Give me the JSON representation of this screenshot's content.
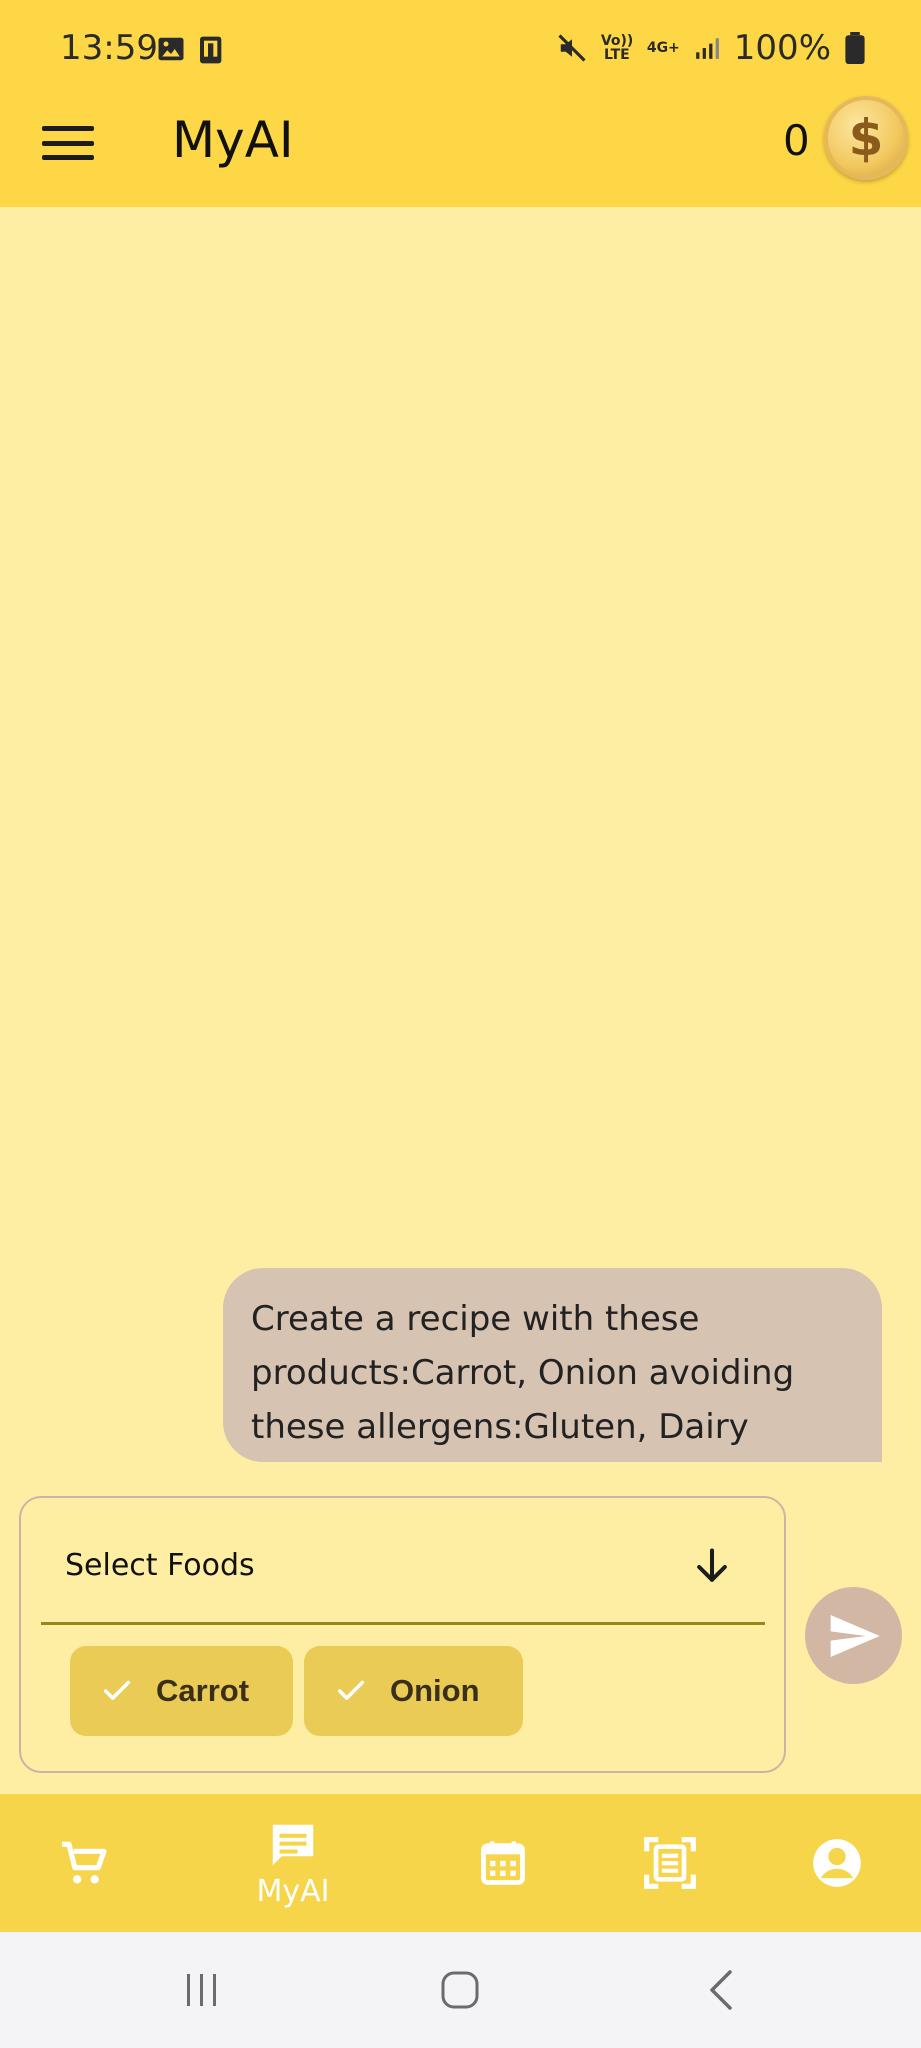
{
  "status_bar": {
    "time": "13:59",
    "battery": "100%",
    "volte": "Vo)) LTE",
    "network": "4G+"
  },
  "app_bar": {
    "title": "MyAI",
    "coin_count": "0",
    "coin_symbol": "$"
  },
  "chat": {
    "messages": [
      {
        "role": "user",
        "text": "Create a recipe with these products:Carrot, Onion avoiding these allergens:Gluten, Dairy"
      }
    ]
  },
  "food_select": {
    "label": "Select Foods",
    "chips": [
      {
        "label": "Carrot",
        "selected": true
      },
      {
        "label": "Onion",
        "selected": true
      }
    ]
  },
  "bottom_nav": {
    "items": [
      {
        "name": "shop",
        "icon": "cart-icon",
        "label": ""
      },
      {
        "name": "myai",
        "icon": "chat-icon",
        "label": "MyAI",
        "active": true
      },
      {
        "name": "calendar",
        "icon": "calendar-icon",
        "label": ""
      },
      {
        "name": "scan",
        "icon": "scan-icon",
        "label": ""
      },
      {
        "name": "profile",
        "icon": "account-icon",
        "label": ""
      }
    ]
  },
  "colors": {
    "app_bar": "#FED746",
    "background": "#FEEEA4",
    "bubble": "#D7C3B1",
    "chip": "#EACB55",
    "nav": "#F6D54A"
  }
}
